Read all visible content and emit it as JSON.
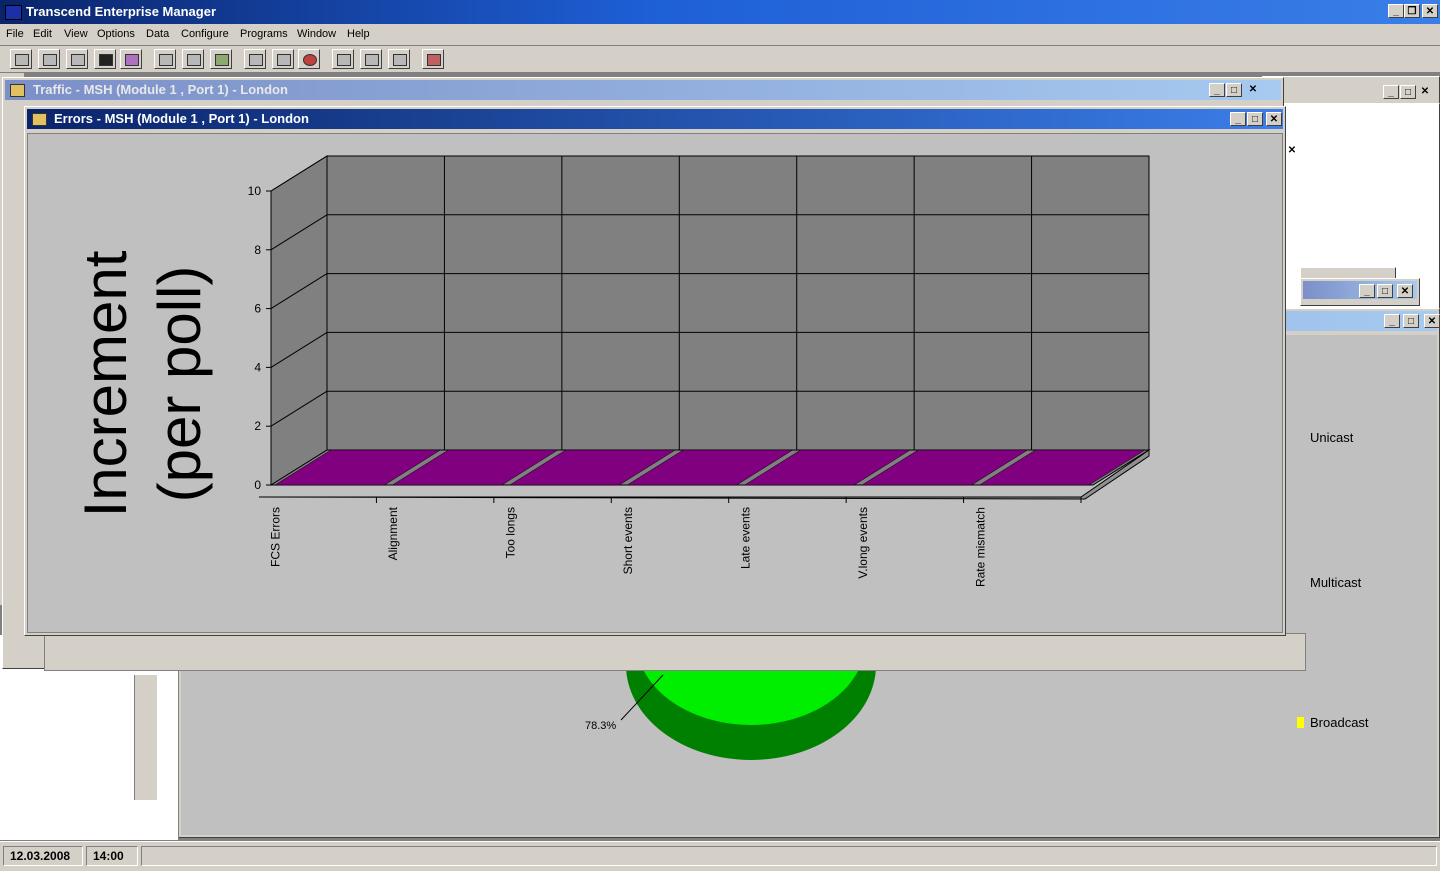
{
  "app": {
    "title": "Transcend Enterprise Manager"
  },
  "menu": [
    "File",
    "Edit",
    "View",
    "Options",
    "Data",
    "Configure",
    "Programs",
    "Window",
    "Help"
  ],
  "toolbar_icons": [
    "new-window-icon",
    "copy-window-icon",
    "export-icon",
    "add-device-icon",
    "print-icon",
    "tools-icon",
    "settings-icon",
    "map-icon",
    "link-icon",
    "grid-icon",
    "target-icon",
    "panel-icon",
    "table-icon",
    "keyboard-icon",
    "delete-icon"
  ],
  "windows": {
    "traffic": {
      "title": "Traffic - MSH (Module 1 , Port 1) - London"
    },
    "errors": {
      "title": "Errors - MSH (Module 1 , Port 1) - London"
    }
  },
  "background_legend": {
    "unicast": "Unicast",
    "multicast": "Multicast",
    "broadcast": "Broadcast",
    "broadcast_color": "#ffff00",
    "pie_label": "78.3%"
  },
  "chart_data": {
    "type": "bar",
    "title": "",
    "xlabel": "",
    "ylabel": "Increment (per poll)",
    "ylabel_lines": [
      "Increment",
      "(per poll)"
    ],
    "categories": [
      "FCS Errors",
      "Alignment",
      "Too longs",
      "Short events",
      "Late events",
      "V.long events",
      "Rate mismatch"
    ],
    "values": [
      0,
      0,
      0,
      0,
      0,
      0,
      0
    ],
    "ylim": [
      0,
      10
    ],
    "yticks": [
      0,
      2,
      4,
      6,
      8,
      10
    ],
    "bar_color": "#800080",
    "wall_color": "#808080",
    "grid": true,
    "three_d": true
  },
  "status": {
    "date": "12.03.2008",
    "time": "14:00"
  }
}
